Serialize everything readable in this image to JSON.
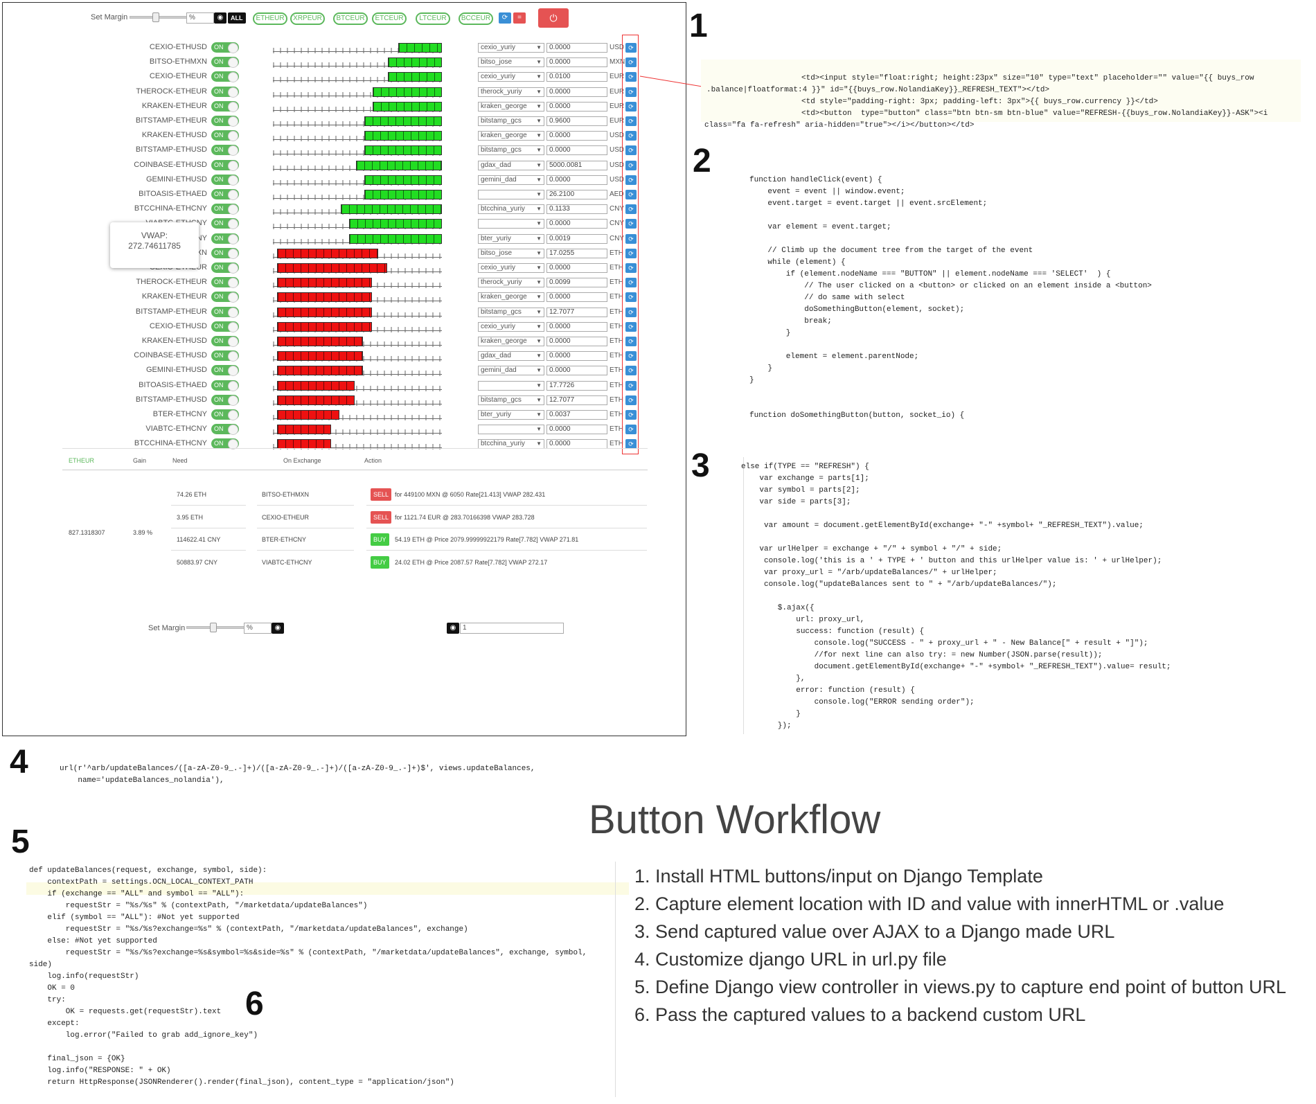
{
  "app": {
    "set_margin_label": "Set Margin",
    "pct": "%",
    "all_label": "ALL",
    "pills": [
      "ETHEUR",
      "XRPEUR",
      "BTCEUR",
      "ETCEUR",
      "LTCEUR",
      "BCCEUR"
    ],
    "on": "ON",
    "rows": [
      {
        "name": "CEXIO-ETHUSD",
        "side": "buy",
        "bar": 0.26,
        "user": "cexio_yuriy",
        "value": "0.0000",
        "cur": "USD"
      },
      {
        "name": "BITSO-ETHMXN",
        "side": "buy",
        "bar": 0.32,
        "user": "bitso_jose",
        "value": "0.0000",
        "cur": "MXN"
      },
      {
        "name": "CEXIO-ETHEUR",
        "side": "buy",
        "bar": 0.32,
        "user": "cexio_yuriy",
        "value": "0.0100",
        "cur": "EUR"
      },
      {
        "name": "THEROCK-ETHEUR",
        "side": "buy",
        "bar": 0.41,
        "user": "therock_yuriy",
        "value": "0.0000",
        "cur": "EUR"
      },
      {
        "name": "KRAKEN-ETHEUR",
        "side": "buy",
        "bar": 0.41,
        "user": "kraken_george",
        "value": "0.0000",
        "cur": "EUR"
      },
      {
        "name": "BITSTAMP-ETHEUR",
        "side": "buy",
        "bar": 0.46,
        "user": "bitstamp_gcs",
        "value": "0.9600",
        "cur": "EUR"
      },
      {
        "name": "KRAKEN-ETHUSD",
        "side": "buy",
        "bar": 0.46,
        "user": "kraken_george",
        "value": "0.0000",
        "cur": "USD"
      },
      {
        "name": "BITSTAMP-ETHUSD",
        "side": "buy",
        "bar": 0.46,
        "user": "bitstamp_gcs",
        "value": "0.0000",
        "cur": "USD"
      },
      {
        "name": "COINBASE-ETHUSD",
        "side": "buy",
        "bar": 0.51,
        "user": "gdax_dad",
        "value": "5000.0081",
        "cur": "USD"
      },
      {
        "name": "GEMINI-ETHUSD",
        "side": "buy",
        "bar": 0.46,
        "user": "gemini_dad",
        "value": "0.0000",
        "cur": "USD"
      },
      {
        "name": "BITOASIS-ETHAED",
        "side": "buy",
        "bar": 0.46,
        "user": "",
        "value": "26.2100",
        "cur": "AED"
      },
      {
        "name": "BTCCHINA-ETHCNY",
        "side": "buy",
        "bar": 0.6,
        "user": "btcchina_yuriy",
        "value": "0.1133",
        "cur": "CNY"
      },
      {
        "name": "VIABTC-ETHCNY",
        "side": "buy",
        "bar": 0.55,
        "user": "",
        "value": "0.0000",
        "cur": "CNY"
      },
      {
        "name": "BTER-ETHCNY",
        "side": "buy",
        "bar": 0.55,
        "user": "bter_yuriy",
        "value": "0.0019",
        "cur": "CNY"
      },
      {
        "name": "BITSO-ETHMXN",
        "side": "sell",
        "bar": 0.6,
        "user": "bitso_jose",
        "value": "17.0255",
        "cur": "ETH"
      },
      {
        "name": "CEXIO-ETHEUR",
        "side": "sell",
        "bar": 0.65,
        "user": "cexio_yuriy",
        "value": "0.0000",
        "cur": "ETH"
      },
      {
        "name": "THEROCK-ETHEUR",
        "side": "sell",
        "bar": 0.56,
        "user": "therock_yuriy",
        "value": "0.0099",
        "cur": "ETH"
      },
      {
        "name": "KRAKEN-ETHEUR",
        "side": "sell",
        "bar": 0.56,
        "user": "kraken_george",
        "value": "0.0000",
        "cur": "ETH"
      },
      {
        "name": "BITSTAMP-ETHEUR",
        "side": "sell",
        "bar": 0.56,
        "user": "bitstamp_gcs",
        "value": "12.7077",
        "cur": "ETH"
      },
      {
        "name": "CEXIO-ETHUSD",
        "side": "sell",
        "bar": 0.56,
        "user": "cexio_yuriy",
        "value": "0.0000",
        "cur": "ETH"
      },
      {
        "name": "KRAKEN-ETHUSD",
        "side": "sell",
        "bar": 0.51,
        "user": "kraken_george",
        "value": "0.0000",
        "cur": "ETH"
      },
      {
        "name": "COINBASE-ETHUSD",
        "side": "sell",
        "bar": 0.51,
        "user": "gdax_dad",
        "value": "0.0000",
        "cur": "ETH"
      },
      {
        "name": "GEMINI-ETHUSD",
        "side": "sell",
        "bar": 0.51,
        "user": "gemini_dad",
        "value": "0.0000",
        "cur": "ETH"
      },
      {
        "name": "BITOASIS-ETHAED",
        "side": "sell",
        "bar": 0.46,
        "user": "",
        "value": "17.7726",
        "cur": "ETH"
      },
      {
        "name": "BITSTAMP-ETHUSD",
        "side": "sell",
        "bar": 0.46,
        "user": "bitstamp_gcs",
        "value": "12.7077",
        "cur": "ETH"
      },
      {
        "name": "BTER-ETHCNY",
        "side": "sell",
        "bar": 0.37,
        "user": "bter_yuriy",
        "value": "0.0037",
        "cur": "ETH"
      },
      {
        "name": "VIABTC-ETHCNY",
        "side": "sell",
        "bar": 0.32,
        "user": "",
        "value": "0.0000",
        "cur": "ETH"
      },
      {
        "name": "BTCCHINA-ETHCNY",
        "side": "sell",
        "bar": 0.32,
        "user": "btcchina_yuriy",
        "value": "0.0000",
        "cur": "ETH"
      }
    ],
    "tooltip": {
      "label": "VWAP:",
      "value": "272.74611785"
    },
    "table": {
      "headers": [
        "ETHEUR",
        "Gain",
        "Need",
        "On Exchange",
        "Action"
      ],
      "gain_total": "827.1318307",
      "gain_pct": "3.89 %",
      "rows": [
        {
          "need": "74.26 ETH",
          "exchange": "BITSO-ETHMXN",
          "action": "SELL",
          "detail": "for 449100 MXN @ 6050 Rate[21.413] VWAP 282.431"
        },
        {
          "need": "3.95 ETH",
          "exchange": "CEXIO-ETHEUR",
          "action": "SELL",
          "detail": "for 1121.74 EUR @ 283.70166398 VWAP 283.728"
        },
        {
          "need": "114622.41 CNY",
          "exchange": "BTER-ETHCNY",
          "action": "BUY",
          "detail": "54.19 ETH @ Price 2079.99999922179 Rate[7.782] VWAP 271.81"
        },
        {
          "need": "50883.97 CNY",
          "exchange": "VIABTC-ETHCNY",
          "action": "BUY",
          "detail": "24.02 ETH @ Price 2087.57 Rate[7.782] VWAP 272.17"
        }
      ]
    },
    "bottom_margin_label": "Set Margin",
    "bottom_input": "1"
  },
  "numbers": [
    "1",
    "2",
    "3",
    "4",
    "5",
    "6"
  ],
  "title": "Button Workflow",
  "steps": [
    "1. Install HTML buttons/input on Django Template",
    "2. Capture element location with ID and value with innerHTML or .value",
    "3. Send captured value over AJAX to a Django made URL",
    "4. Customize django URL in url.py file",
    "5. Define Django view controller in views.py to capture end point of button URL",
    "6. Pass the captured values to a backend custom URL"
  ],
  "code1": [
    "<td><input style=\"float:right; height:23px\" size=\"10\" type=\"text\" placeholder=\"\" value=\"{{ buys_row",
    ".balance|floatformat:4 }}\" id=\"{{buys_row.NolandiaKey}}_REFRESH_TEXT\"></td>",
    "<td style=\"padding-right: 3px; padding-left: 3px\">{{ buys_row.currency }}</td>",
    "<td><button  type=\"button\" class=\"btn btn-sm btn-blue\" value=\"REFRESH-{{buys_row.NolandiaKey}}-ASK\"><i",
    "class=\"fa fa-refresh\" aria-hidden=\"true\"></i></button></td>"
  ],
  "code2": [
    "function handleClick(event) {",
    "    event = event || window.event;",
    "    event.target = event.target || event.srcElement;",
    "",
    "    var element = event.target;",
    "",
    "    // Climb up the document tree from the target of the event",
    "    while (element) {",
    "        if (element.nodeName === \"BUTTON\" || element.nodeName === 'SELECT'  ) {",
    "            // The user clicked on a <button> or clicked on an element inside a <button>",
    "            // do same with select",
    "            doSomethingButton(element, socket);",
    "            break;",
    "        }",
    "",
    "        element = element.parentNode;",
    "    }",
    "}",
    "",
    "",
    "function doSomethingButton(button, socket_io) {"
  ],
  "code3": [
    "else if(TYPE == \"REFRESH\") {",
    "    var exchange = parts[1];",
    "    var symbol = parts[2];",
    "    var side = parts[3];",
    "",
    "     var amount = document.getElementById(exchange+ \"-\" +symbol+ \"_REFRESH_TEXT\").value;",
    "",
    "    var urlHelper = exchange + \"/\" + symbol + \"/\" + side;",
    "     console.log('this is a ' + TYPE + ' button and this urlHelper value is: ' + urlHelper);",
    "     var proxy_url = \"/arb/updateBalances/\" + urlHelper;",
    "     console.log(\"updateBalances sent to \" + \"/arb/updateBalances/\");",
    "",
    "        $.ajax({",
    "            url: proxy_url,",
    "            success: function (result) {",
    "                console.log(\"SUCCESS - \" + proxy_url + \" - New Balance[\" + result + \"]\");",
    "                //for next line can also try: = new Number(JSON.parse(result));",
    "                document.getElementById(exchange+ \"-\" +symbol+ \"_REFRESH_TEXT\").value= result;",
    "            },",
    "            error: function (result) {",
    "                console.log(\"ERROR sending order\");",
    "            }",
    "        });"
  ],
  "code4": [
    "url(r'^arb/updateBalances/([a-zA-Z0-9_.-]+)/([a-zA-Z0-9_.-]+)/([a-zA-Z0-9_.-]+)$', views.updateBalances,",
    "    name='updateBalances_nolandia'),"
  ],
  "code5": [
    "def updateBalances(request, exchange, symbol, side):",
    "    contextPath = settings.OCN_LOCAL_CONTEXT_PATH",
    "    if (exchange == \"ALL\" and symbol == \"ALL\"):",
    "        requestStr = \"%s/%s\" % (contextPath, \"/marketdata/updateBalances\")",
    "    elif (symbol == \"ALL\"): #Not yet supported",
    "        requestStr = \"%s/%s?exchange=%s\" % (contextPath, \"/marketdata/updateBalances\", exchange)",
    "    else: #Not yet supported",
    "        requestStr = \"%s/%s?exchange=%s&symbol=%s&side=%s\" % (contextPath, \"/marketdata/updateBalances\", exchange, symbol,",
    "side)",
    "    log.info(requestStr)",
    "    OK = 0",
    "    try:",
    "        OK = requests.get(requestStr).text",
    "    except:",
    "        log.error(\"Failed to grab add_ignore_key\")",
    "",
    "    final_json = {OK}",
    "    log.info(\"RESPONSE: \" + OK)",
    "    return HttpResponse(JSONRenderer().render(final_json), content_type = \"application/json\")"
  ]
}
